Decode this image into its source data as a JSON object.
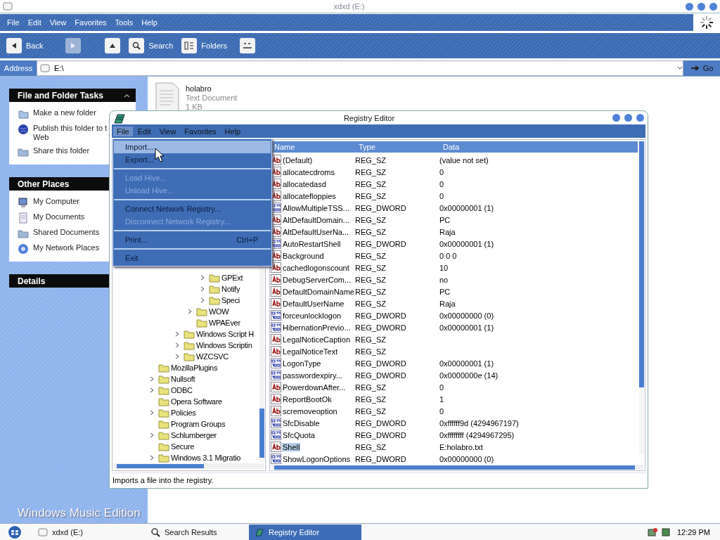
{
  "explorer": {
    "title": "xdxd (E:)",
    "menu": [
      "File",
      "Edit",
      "View",
      "Favorites",
      "Tools",
      "Help"
    ],
    "toolbar": [
      {
        "kind": "back",
        "label": "Back",
        "disabled": false
      },
      {
        "kind": "forward",
        "disabled": true
      },
      {
        "kind": "up",
        "disabled": false
      },
      {
        "kind": "search",
        "label": "Search",
        "disabled": false
      },
      {
        "kind": "folders",
        "label": "Folders",
        "disabled": false
      },
      {
        "kind": "views",
        "disabled": false
      }
    ],
    "address": {
      "label": "Address",
      "value": "E:\\",
      "go": "Go"
    },
    "task_panels": [
      {
        "title": "File and Folder Tasks",
        "collapsible": true,
        "items": [
          {
            "kind": "folder",
            "lines": [
              "Make a new folder"
            ]
          },
          {
            "kind": "globe",
            "lines": [
              "Publish this folder to t",
              "Web"
            ]
          },
          {
            "kind": "share",
            "lines": [
              "Share this folder"
            ]
          }
        ]
      },
      {
        "title": "Other Places",
        "collapsible": false,
        "items": [
          {
            "kind": "computer",
            "lines": [
              "My Computer"
            ]
          },
          {
            "kind": "documents",
            "lines": [
              "My Documents"
            ]
          },
          {
            "kind": "share",
            "lines": [
              "Shared Documents"
            ]
          },
          {
            "kind": "network",
            "lines": [
              "My Network Places"
            ]
          }
        ]
      },
      {
        "title": "Details",
        "collapsible": false
      }
    ],
    "edition_label": "Windows Music Edition",
    "files": [
      {
        "name": "holabro",
        "type": "Text Document",
        "size": "1 KB"
      }
    ]
  },
  "registry_editor": {
    "title": "Registry Editor",
    "menu": [
      {
        "label": "File",
        "selected": true
      },
      {
        "label": "Edit",
        "selected": false
      },
      {
        "label": "View",
        "selected": false
      },
      {
        "label": "Favorites",
        "selected": false
      },
      {
        "label": "Help",
        "selected": false
      }
    ],
    "file_menu": [
      {
        "items": [
          {
            "label": "Import...",
            "selected": true,
            "disabled": false
          },
          {
            "label": "Export...",
            "selected": false,
            "disabled": false
          }
        ]
      },
      {
        "items": [
          {
            "label": "Load Hive...",
            "selected": false,
            "disabled": true
          },
          {
            "label": "Unload Hive...",
            "selected": false,
            "disabled": true
          }
        ]
      },
      {
        "items": [
          {
            "label": "Connect Network Registry...",
            "selected": false,
            "disabled": false
          },
          {
            "label": "Disconnect Network Registry...",
            "selected": false,
            "disabled": true
          }
        ]
      },
      {
        "items": [
          {
            "label": "Print...",
            "shortcut": "Ctrl+P",
            "selected": false,
            "disabled": false
          }
        ]
      },
      {
        "items": [
          {
            "label": "Exit",
            "selected": false,
            "disabled": false
          }
        ]
      }
    ],
    "tree": [
      {
        "children": [
          {
            "children": [
              {
                "children": [
                  {
                    "children": [
                      {
                        "label": "GPExt",
                        "expandable": true
                      },
                      {
                        "label": "Notify",
                        "expandable": true
                      },
                      {
                        "label": "Speci",
                        "expandable": true
                      }
                    ]
                  },
                  {
                    "label": "WOW",
                    "expandable": true
                  },
                  {
                    "label": "WPAEver",
                    "expandable": false
                  }
                ]
              },
              {
                "label": "Windows Script H",
                "expandable": true
              },
              {
                "label": "Windows Scriptin",
                "expandable": true
              },
              {
                "label": "WZCSVC",
                "expandable": true
              }
            ]
          }
        ]
      },
      {
        "label": "MozillaPlugins",
        "expandable": false
      },
      {
        "label": "Nullsoft",
        "expandable": true
      },
      {
        "label": "ODBC",
        "expandable": true
      },
      {
        "label": "Opera Software",
        "expandable": false
      },
      {
        "label": "Policies",
        "expandable": true
      },
      {
        "label": "Program Groups",
        "expandable": false
      },
      {
        "label": "Schlumberger",
        "expandable": true
      },
      {
        "label": "Secure",
        "expandable": false
      },
      {
        "label": "Windows 3.1 Migratio",
        "expandable": true
      }
    ],
    "columns": [
      "Name",
      "Type",
      "Data"
    ],
    "values": [
      {
        "kind": "string",
        "name": "(Default)",
        "type": "REG_SZ",
        "data": "(value not set)",
        "selected": false
      },
      {
        "kind": "string",
        "name": "allocatecdroms",
        "type": "REG_SZ",
        "data": "0",
        "selected": false
      },
      {
        "kind": "string",
        "name": "allocatedasd",
        "type": "REG_SZ",
        "data": "0",
        "selected": false
      },
      {
        "kind": "string",
        "name": "allocatefloppies",
        "type": "REG_SZ",
        "data": "0",
        "selected": false
      },
      {
        "kind": "binary",
        "name": "AllowMultipleTSS...",
        "type": "REG_DWORD",
        "data": "0x00000001 (1)",
        "selected": false
      },
      {
        "kind": "string",
        "name": "AltDefaultDomain...",
        "type": "REG_SZ",
        "data": "PC",
        "selected": false
      },
      {
        "kind": "string",
        "name": "AltDefaultUserNa...",
        "type": "REG_SZ",
        "data": "Raja",
        "selected": false
      },
      {
        "kind": "binary",
        "name": "AutoRestartShell",
        "type": "REG_DWORD",
        "data": "0x00000001 (1)",
        "selected": false
      },
      {
        "kind": "string",
        "name": "Background",
        "type": "REG_SZ",
        "data": "0 0 0",
        "selected": false
      },
      {
        "kind": "string",
        "name": "cachedlogonscount",
        "type": "REG_SZ",
        "data": "10",
        "selected": false
      },
      {
        "kind": "string",
        "name": "DebugServerCom...",
        "type": "REG_SZ",
        "data": "no",
        "selected": false
      },
      {
        "kind": "string",
        "name": "DefaultDomainName",
        "type": "REG_SZ",
        "data": "PC",
        "selected": false
      },
      {
        "kind": "string",
        "name": "DefaultUserName",
        "type": "REG_SZ",
        "data": "Raja",
        "selected": false
      },
      {
        "kind": "binary",
        "name": "forceunlocklogon",
        "type": "REG_DWORD",
        "data": "0x00000000 (0)",
        "selected": false
      },
      {
        "kind": "binary",
        "name": "HibernationPrevio...",
        "type": "REG_DWORD",
        "data": "0x00000001 (1)",
        "selected": false
      },
      {
        "kind": "string",
        "name": "LegalNoticeCaption",
        "type": "REG_SZ",
        "selected": false
      },
      {
        "kind": "string",
        "name": "LegalNoticeText",
        "type": "REG_SZ",
        "selected": false
      },
      {
        "kind": "binary",
        "name": "LogonType",
        "type": "REG_DWORD",
        "data": "0x00000001 (1)",
        "selected": false
      },
      {
        "kind": "binary",
        "name": "passwordexpiry...",
        "type": "REG_DWORD",
        "data": "0x0000000e (14)",
        "selected": false
      },
      {
        "kind": "string",
        "name": "PowerdownAfter...",
        "type": "REG_SZ",
        "data": "0",
        "selected": false
      },
      {
        "kind": "string",
        "name": "ReportBootOk",
        "type": "REG_SZ",
        "data": "1",
        "selected": false
      },
      {
        "kind": "string",
        "name": "scremoveoption",
        "type": "REG_SZ",
        "data": "0",
        "selected": false
      },
      {
        "kind": "binary",
        "name": "SfcDisable",
        "type": "REG_DWORD",
        "data": "0xffffff9d (4294967197)",
        "selected": false
      },
      {
        "kind": "binary",
        "name": "SfcQuota",
        "type": "REG_DWORD",
        "data": "0xffffffff (4294967295)",
        "selected": false
      },
      {
        "kind": "string",
        "name": "Shell",
        "type": "REG_SZ",
        "data": "E:holabro.txt",
        "selected": true
      },
      {
        "kind": "binary",
        "name": "ShowLogonOptions",
        "type": "REG_DWORD",
        "data": "0x00000000 (0)",
        "selected": false
      }
    ],
    "status": "Imports a file into the registry."
  },
  "taskbar": {
    "tasks": [
      {
        "kind": "drive",
        "label": "xdxd (E:)",
        "selected": false
      },
      {
        "kind": "search",
        "label": "Search Results",
        "selected": false
      },
      {
        "kind": "registry",
        "label": "Registry Editor",
        "selected": true
      }
    ],
    "clock": "12:29 PM"
  }
}
